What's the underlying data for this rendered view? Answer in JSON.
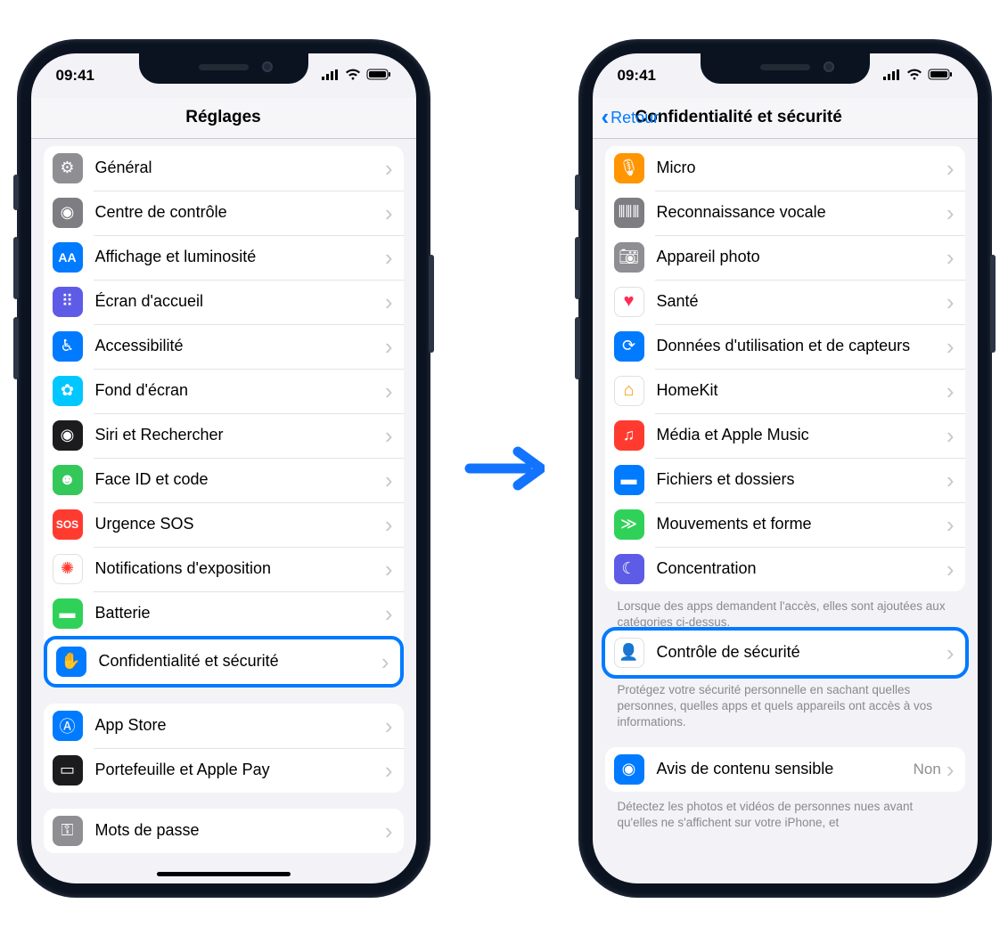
{
  "status": {
    "time": "09:41"
  },
  "left": {
    "title": "Réglages",
    "groups": [
      {
        "items": [
          {
            "id": "general",
            "label": "Général",
            "icon": "gear-icon",
            "bg": "bg-gray"
          },
          {
            "id": "control-center",
            "label": "Centre de contrôle",
            "icon": "toggles-icon",
            "bg": "bg-darkgray"
          },
          {
            "id": "display",
            "label": "Affichage et luminosité",
            "icon": "text-size-icon",
            "bg": "bg-blue"
          },
          {
            "id": "home",
            "label": "Écran d'accueil",
            "icon": "apps-grid-icon",
            "bg": "bg-purple"
          },
          {
            "id": "accessibility",
            "label": "Accessibilité",
            "icon": "accessibility-icon",
            "bg": "bg-blue"
          },
          {
            "id": "wallpaper",
            "label": "Fond d'écran",
            "icon": "flower-icon",
            "bg": "bg-cyanlight"
          },
          {
            "id": "siri",
            "label": "Siri et Rechercher",
            "icon": "siri-icon",
            "bg": "bg-black"
          },
          {
            "id": "faceid",
            "label": "Face ID et code",
            "icon": "faceid-icon",
            "bg": "bg-green"
          },
          {
            "id": "sos",
            "label": "Urgence SOS",
            "icon": "sos-icon",
            "bg": "bg-red"
          },
          {
            "id": "exposure",
            "label": "Notifications d'exposition",
            "icon": "exposure-icon",
            "bg": "bg-white"
          },
          {
            "id": "battery",
            "label": "Batterie",
            "icon": "battery-icon",
            "bg": "bg-green2"
          },
          {
            "id": "privacy",
            "label": "Confidentialité et sécurité",
            "icon": "hand-icon",
            "bg": "bg-blue",
            "highlighted": true
          }
        ]
      },
      {
        "items": [
          {
            "id": "appstore",
            "label": "App Store",
            "icon": "appstore-icon",
            "bg": "bg-blue"
          },
          {
            "id": "wallet",
            "label": "Portefeuille et Apple Pay",
            "icon": "wallet-icon",
            "bg": "bg-black"
          }
        ]
      },
      {
        "items": [
          {
            "id": "passwords",
            "label": "Mots de passe",
            "icon": "key-icon",
            "bg": "bg-gray"
          }
        ]
      }
    ]
  },
  "right": {
    "back": "Retour",
    "title": "Confidentialité et sécurité",
    "groups": [
      {
        "items": [
          {
            "id": "microphone",
            "label": "Micro",
            "icon": "microphone-icon",
            "bg": "bg-orange"
          },
          {
            "id": "speech",
            "label": "Reconnaissance vocale",
            "icon": "waveform-icon",
            "bg": "bg-darkgray"
          },
          {
            "id": "camera",
            "label": "Appareil photo",
            "icon": "camera-icon",
            "bg": "bg-gray"
          },
          {
            "id": "health",
            "label": "Santé",
            "icon": "heart-icon",
            "bg": "bg-white"
          },
          {
            "id": "research",
            "label": "Données d'utilisation et de capteurs",
            "icon": "research-icon",
            "bg": "bg-blue"
          },
          {
            "id": "homekit",
            "label": "HomeKit",
            "icon": "home-icon",
            "bg": "bg-white"
          },
          {
            "id": "media",
            "label": "Média et Apple Music",
            "icon": "music-icon",
            "bg": "bg-red"
          },
          {
            "id": "files",
            "label": "Fichiers et dossiers",
            "icon": "folder-icon",
            "bg": "bg-blue"
          },
          {
            "id": "motion",
            "label": "Mouvements et forme",
            "icon": "running-icon",
            "bg": "bg-green2"
          },
          {
            "id": "focus",
            "label": "Concentration",
            "icon": "moon-icon",
            "bg": "bg-purple"
          }
        ],
        "footer": "Lorsque des apps demandent l'accès, elles sont ajoutées aux catégories ci-dessus."
      },
      {
        "items": [
          {
            "id": "safety-check",
            "label": "Contrôle de sécurité",
            "icon": "person-shield-icon",
            "bg": "bg-white",
            "highlighted": true
          }
        ],
        "footer": "Protégez votre sécurité personnelle en sachant quelles personnes, quelles apps et quels appareils ont accès à vos informations."
      },
      {
        "items": [
          {
            "id": "sensitive",
            "label": "Avis de contenu sensible",
            "icon": "eye-warning-icon",
            "bg": "bg-blue",
            "value": "Non"
          }
        ],
        "footer": "Détectez les photos et vidéos de personnes nues avant qu'elles ne s'affichent sur votre iPhone, et"
      }
    ]
  }
}
